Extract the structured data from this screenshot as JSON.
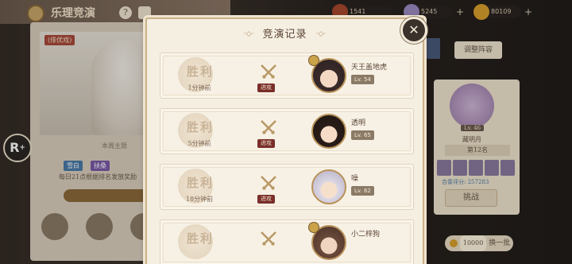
{
  "background": {
    "title": "乐理竞演",
    "help_label": "?",
    "left_badge": "(俳优戏)",
    "mid_text": "本周主题",
    "tag1": "雪白",
    "tag2": "扶桑",
    "desc": "每日21点根据排名发放奖励",
    "resources": [
      {
        "value": "1541",
        "icon": "token-icon"
      },
      {
        "value": "5245",
        "icon": "gem-icon"
      },
      {
        "value": "80109",
        "icon": "gold-coin-icon"
      }
    ],
    "right_btn": "调整阵容",
    "right_lv": "Lv. 46",
    "right_name": "藏明月",
    "right_rank": "第12名",
    "right_power_label": "合奏评分: 257283",
    "challenge": "挑战",
    "refresh_cost": "10000",
    "refresh_label": "换一批"
  },
  "modal": {
    "title": "竞演记录",
    "close_icon": "close-x-icon",
    "records": [
      {
        "result": "胜利",
        "time": "1分钟前",
        "tag": "进攻",
        "name": "天王盖地虎",
        "level": "Lv. 54"
      },
      {
        "result": "胜利",
        "time": "5分钟前",
        "tag": "进攻",
        "name": "透明",
        "level": "Lv. 65"
      },
      {
        "result": "胜利",
        "time": "18分钟前",
        "tag": "进攻",
        "name": "噪",
        "level": "Lv. 62"
      },
      {
        "result": "胜利",
        "time": "",
        "tag": "",
        "name": "小二梓狗",
        "level": ""
      }
    ]
  },
  "colors": {
    "modal_bg": "#f5efe2",
    "attack_tag": "#7a2e2a",
    "seal_text": "#c9b397"
  }
}
